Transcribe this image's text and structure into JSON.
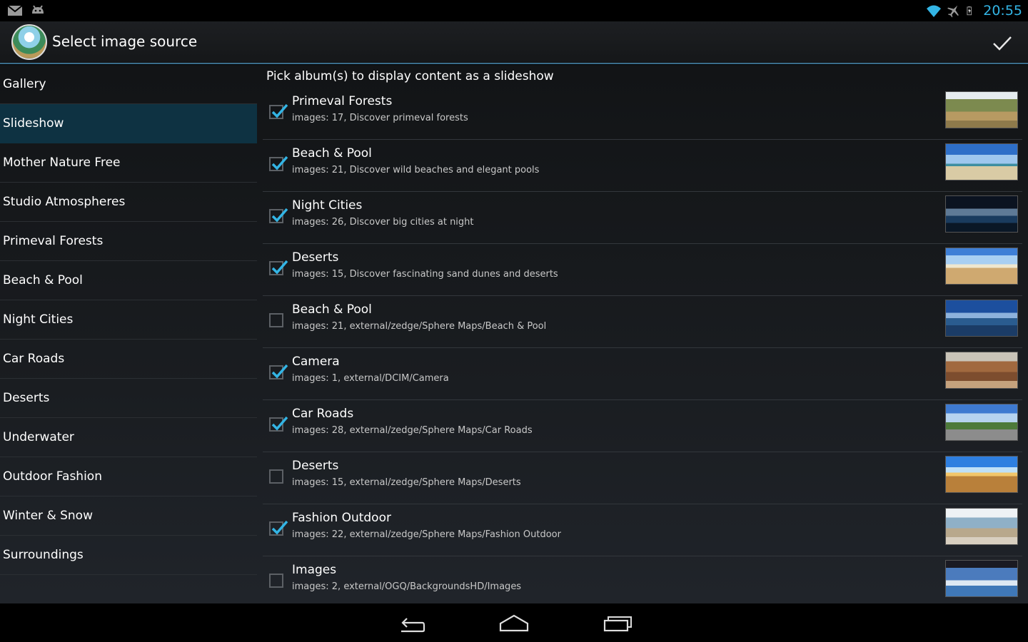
{
  "status_bar": {
    "left_icons": [
      "gmail-icon",
      "android-debug-icon"
    ],
    "right_icons": [
      "wifi-icon",
      "airplane-mode-icon",
      "battery-icon"
    ],
    "time": "20:55"
  },
  "action_bar": {
    "title": "Select image source",
    "done_icon": "checkmark-icon"
  },
  "sidebar": {
    "items": [
      {
        "label": "Gallery",
        "active": false
      },
      {
        "label": "Slideshow",
        "active": true
      },
      {
        "label": "Mother Nature Free",
        "active": false
      },
      {
        "label": "Studio Atmospheres",
        "active": false
      },
      {
        "label": "Primeval Forests",
        "active": false
      },
      {
        "label": "Beach & Pool",
        "active": false
      },
      {
        "label": "Night Cities",
        "active": false
      },
      {
        "label": "Car Roads",
        "active": false
      },
      {
        "label": "Deserts",
        "active": false
      },
      {
        "label": "Underwater",
        "active": false
      },
      {
        "label": "Outdoor Fashion",
        "active": false
      },
      {
        "label": "Winter & Snow",
        "active": false
      },
      {
        "label": "Surroundings",
        "active": false
      }
    ]
  },
  "content": {
    "hint": "Pick album(s) to display content as a slideshow",
    "albums": [
      {
        "title": "Primeval Forests",
        "subtitle": "images: 17, Discover primeval forests",
        "checked": true,
        "thumb": "forest"
      },
      {
        "title": "Beach & Pool",
        "subtitle": "images: 21, Discover wild beaches and elegant pools",
        "checked": true,
        "thumb": "beach"
      },
      {
        "title": "Night Cities",
        "subtitle": "images: 26, Discover big cities at night",
        "checked": true,
        "thumb": "night"
      },
      {
        "title": "Deserts",
        "subtitle": "images: 15, Discover fascinating sand dunes and deserts",
        "checked": true,
        "thumb": "desert"
      },
      {
        "title": "Beach & Pool",
        "subtitle": "images: 21, external/zedge/Sphere Maps/Beach & Pool",
        "checked": false,
        "thumb": "sea"
      },
      {
        "title": "Camera",
        "subtitle": "images: 1, external/DCIM/Camera",
        "checked": true,
        "thumb": "room"
      },
      {
        "title": "Car Roads",
        "subtitle": "images: 28, external/zedge/Sphere Maps/Car Roads",
        "checked": true,
        "thumb": "road"
      },
      {
        "title": "Deserts",
        "subtitle": "images: 15, external/zedge/Sphere Maps/Deserts",
        "checked": false,
        "thumb": "desert2"
      },
      {
        "title": "Fashion Outdoor",
        "subtitle": "images: 22, external/zedge/Sphere Maps/Fashion Outdoor",
        "checked": true,
        "thumb": "fashion"
      },
      {
        "title": "Images",
        "subtitle": "images: 2, external/OGQ/BackgroundsHD/Images",
        "checked": false,
        "thumb": "coast"
      }
    ]
  },
  "nav_bar": {
    "buttons": [
      "back-icon",
      "home-icon",
      "recents-icon"
    ]
  },
  "colors": {
    "accent": "#33b5e5",
    "active_nav": "#0e3242",
    "action_bar_divider": "#3a6d8b"
  }
}
